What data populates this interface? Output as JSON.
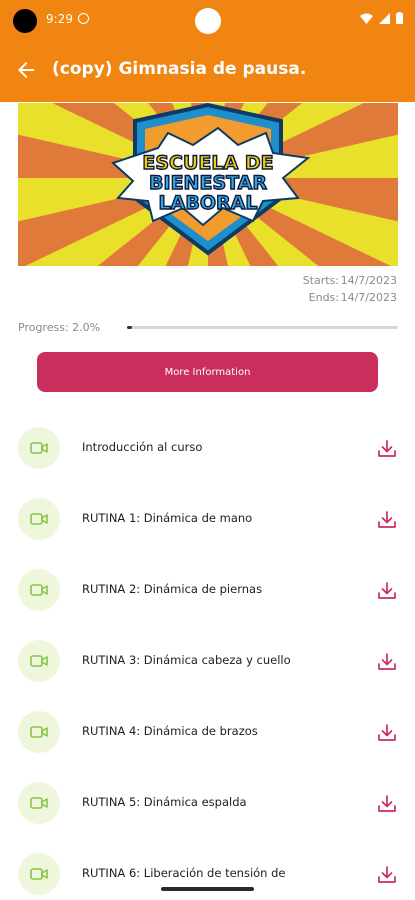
{
  "status_bar": {
    "time": "9:29"
  },
  "header": {
    "title": "(copy) Gimnasia de pausa."
  },
  "banner": {
    "line1": "ESCUELA DE",
    "line2": "BIENESTAR",
    "line3": "LABORAL"
  },
  "course": {
    "starts_label": "Starts:",
    "starts_value": "14/7/2023",
    "ends_label": "Ends:",
    "ends_value": "14/7/2023",
    "progress_label": "Progress: 2.0%",
    "progress_value": 0.02,
    "more_info_label": "More Information"
  },
  "lessons": [
    {
      "title": "Introducción al curso"
    },
    {
      "title": "RUTINA 1: Dinámica de mano"
    },
    {
      "title": "RUTINA 2: Dinámica de piernas"
    },
    {
      "title": "RUTINA 3: Dinámica cabeza y cuello"
    },
    {
      "title": "RUTINA 4: Dinámica de brazos"
    },
    {
      "title": "RUTINA 5: Dinámica espalda"
    },
    {
      "title": "RUTINA 6: Liberación de tensión de"
    }
  ],
  "colors": {
    "appbar": "#F08512",
    "accent": "#C92E5C",
    "icon_green": "#8BC34A"
  }
}
